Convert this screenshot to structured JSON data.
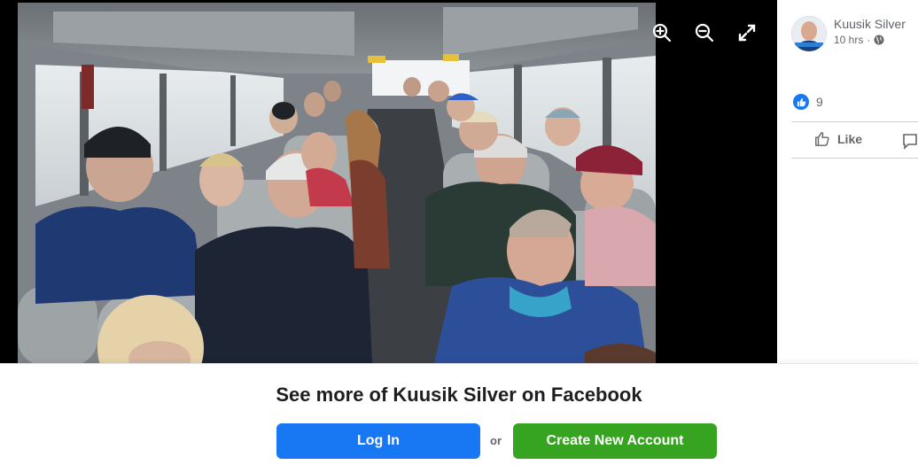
{
  "viewer": {
    "photo_alt": "",
    "tools": [
      "zoom-in-icon",
      "zoom-out-icon",
      "fullscreen-icon"
    ]
  },
  "post": {
    "author_name": "Kuusik Silver",
    "time": "10 hrs",
    "separator": "·",
    "audience_icon": "globe-icon",
    "reaction_count": "9",
    "like_label": "Like"
  },
  "promo": {
    "title": "See more of Kuusik Silver on Facebook",
    "login_label": "Log In",
    "or_label": "or",
    "create_label": "Create New Account"
  },
  "colors": {
    "brand_blue": "#1877f2",
    "create_green": "#36a420",
    "viewer_bg": "#000000"
  }
}
